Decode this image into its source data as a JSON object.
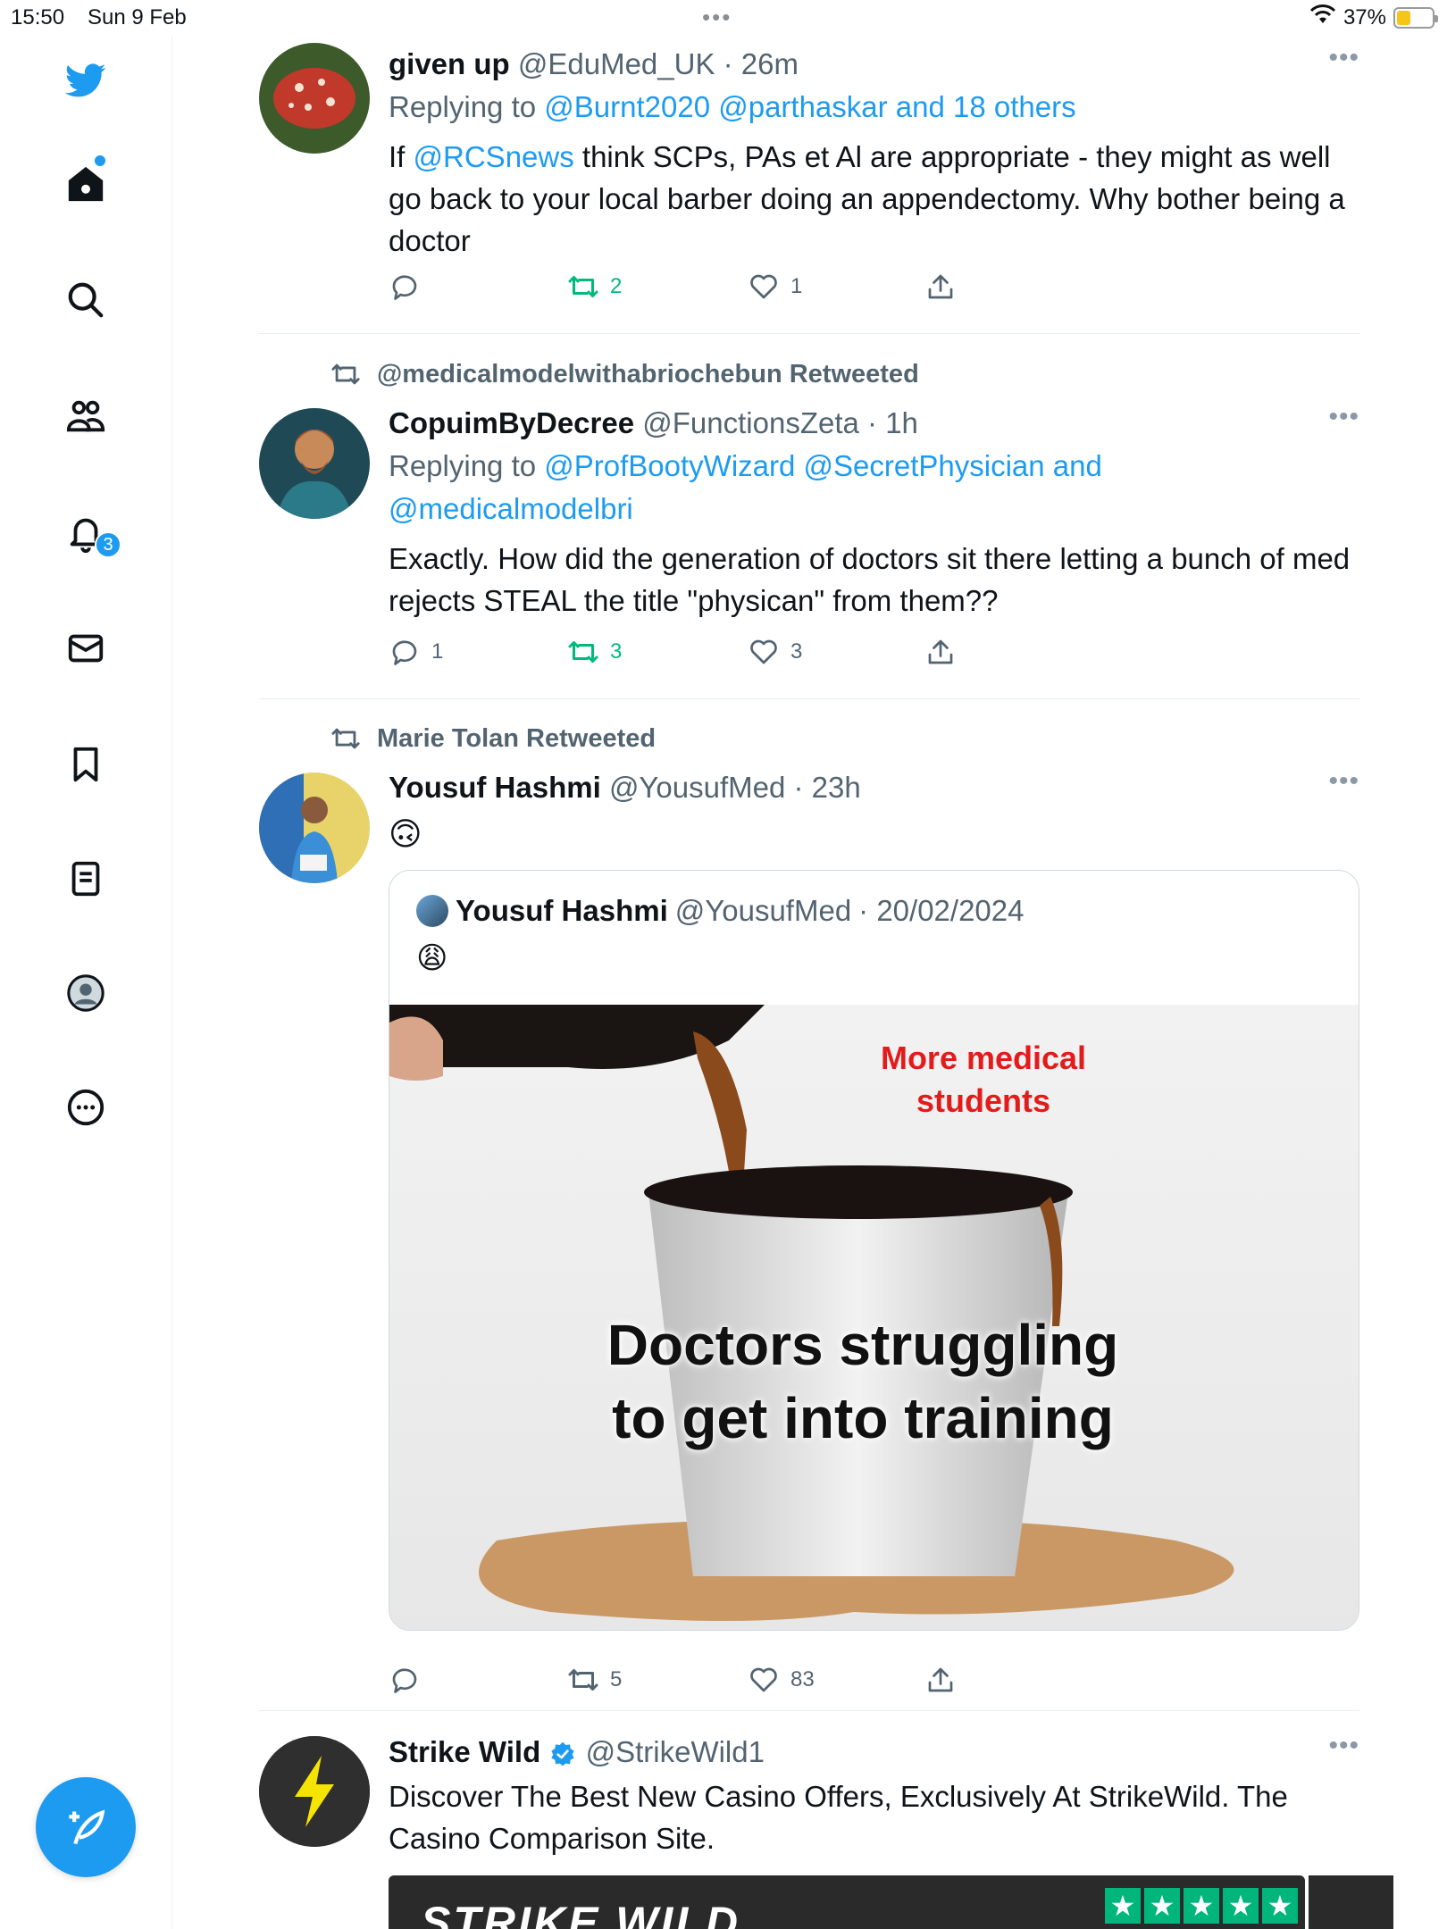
{
  "status_bar": {
    "time": "15:50",
    "date": "Sun 9 Feb",
    "dots": "•••",
    "battery": "37%"
  },
  "sidebar": {
    "notifications_badge": "3"
  },
  "tweets": [
    {
      "name": "given up",
      "handle": "@EduMed_UK",
      "time": "· 26m",
      "replying_prefix": "Replying to ",
      "replying_to": "@Burnt2020 @parthaskar and 18 others",
      "text_prefix": "If ",
      "text_mention": "@RCSnews",
      "text_rest": " think SCPs, PAs et Al are appropriate - they might as well go back to your local barber doing an appendectomy. Why bother being a doctor",
      "replies": "",
      "retweets": "2",
      "likes": "1"
    },
    {
      "retweeted_by": "@medicalmodelwithabriochebun Retweeted",
      "name": "CopuimByDecree",
      "handle": "@FunctionsZeta",
      "time": "· 1h",
      "replying_prefix": "Replying to ",
      "replying_line1": "@ProfBootyWizard @SecretPhysician and",
      "replying_line2": "@medicalmodelbri",
      "text": "Exactly. How did the generation of doctors sit there letting a bunch of med rejects STEAL the title \"physican\" from them??",
      "replies": "1",
      "retweets": "3",
      "likes": "3"
    },
    {
      "retweeted_by": "Marie Tolan Retweeted",
      "name": "Yousuf Hashmi",
      "handle": "@YousufMed",
      "time": "· 23h",
      "emoji": "🙃",
      "quote": {
        "name": "Yousuf Hashmi",
        "handle": "@YousufMed",
        "time": "· 20/02/2024",
        "emoji": "😩",
        "meme_top": "More medical students",
        "meme_bottom": "Doctors struggling to get into training"
      },
      "replies": "",
      "retweets": "5",
      "likes": "83"
    },
    {
      "name": "Strike Wild",
      "handle": "@StrikeWild1",
      "text": "Discover The Best New Casino Offers, Exclusively At StrikeWild. The Casino Comparison Site.",
      "banner_logo": "STRIKE WILD"
    }
  ],
  "colors": {
    "accent": "#1d9bf0",
    "retweet_green": "#00ba7c",
    "secondary_text": "#536471"
  }
}
